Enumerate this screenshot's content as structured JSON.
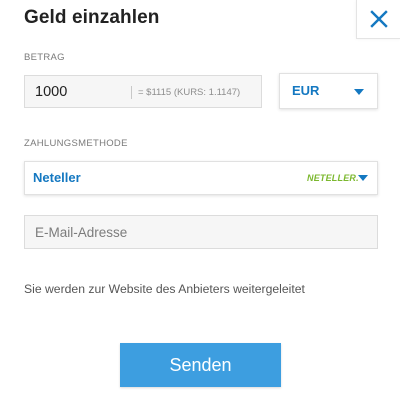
{
  "dialog": {
    "title": "Geld einzahlen",
    "close_icon": "close-icon"
  },
  "amount": {
    "label": "BETRAG",
    "value": "1000",
    "conversion": "= $1115  (KURS: 1.1147)"
  },
  "currency": {
    "selected": "EUR",
    "icon": "caret-down-icon"
  },
  "payment_method": {
    "label": "ZAHLUNGSMETHODE",
    "selected": "Neteller",
    "logo_text": "NETELLER.",
    "icon": "caret-down-icon"
  },
  "email": {
    "placeholder": "E-Mail-Adresse",
    "value": ""
  },
  "info_text": "Sie werden zur Website des Anbieters weitergeleitet",
  "submit": {
    "label": "Senden"
  },
  "colors": {
    "accent": "#1478c1",
    "button": "#3d9ee0",
    "neteller_green": "#7cb82f"
  }
}
